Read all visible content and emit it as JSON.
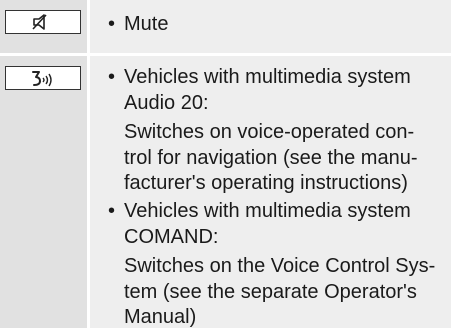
{
  "rows": [
    {
      "icon": "mute-icon",
      "items": [
        {
          "bullet": "•",
          "text": "Mute"
        }
      ]
    },
    {
      "icon": "voice-control-icon",
      "items": [
        {
          "bullet": "•",
          "lines": [
            "Vehicles with multimedia system",
            "Audio 20:"
          ],
          "sub": [
            "Switches on voice-operated con-",
            "trol for navigation (see the manu-",
            "facturer's operating instructions)"
          ]
        },
        {
          "bullet": "•",
          "lines": [
            "Vehicles with multimedia system",
            "COMAND:"
          ],
          "sub": [
            "Switches on the Voice Control Sys-",
            "tem (see the separate Operator's",
            "Manual)"
          ]
        }
      ]
    }
  ]
}
